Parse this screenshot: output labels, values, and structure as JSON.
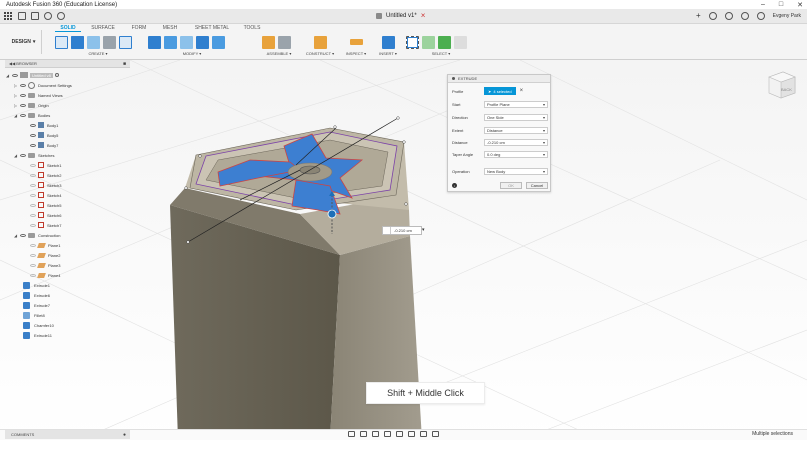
{
  "titlebar": {
    "title": "Autodesk Fusion 360 (Education License)"
  },
  "document": {
    "tab_title": "Untitled v1*"
  },
  "user": {
    "name": "Evgeny Park"
  },
  "workspace": {
    "label": "DESIGN"
  },
  "ribbon": {
    "tabs": [
      "SOLID",
      "SURFACE",
      "FORM",
      "MESH",
      "SHEET METAL",
      "TOOLS"
    ],
    "active_tab": "SOLID",
    "groups": {
      "create": "CREATE",
      "modify": "MODIFY",
      "assemble": "ASSEMBLE",
      "construct": "CONSTRUCT",
      "inspect": "INSPECT",
      "insert": "INSERT",
      "select": "SELECT"
    }
  },
  "browser": {
    "title": "BROWSER",
    "root": "Untitled v8",
    "items": [
      {
        "label": "Document Settings",
        "kind": "settings",
        "indent": 1
      },
      {
        "label": "Named Views",
        "kind": "folder",
        "indent": 1
      },
      {
        "label": "Origin",
        "kind": "folder",
        "indent": 1
      },
      {
        "label": "Bodies",
        "kind": "folder",
        "indent": 1
      },
      {
        "label": "Body1",
        "kind": "body",
        "indent": 2
      },
      {
        "label": "Body5",
        "kind": "body",
        "indent": 2
      },
      {
        "label": "Body7",
        "kind": "body",
        "indent": 2
      },
      {
        "label": "Sketches",
        "kind": "folder",
        "indent": 1
      },
      {
        "label": "Sketch1",
        "kind": "sketch",
        "indent": 2
      },
      {
        "label": "Sketch2",
        "kind": "sketch",
        "indent": 2
      },
      {
        "label": "Sketch3",
        "kind": "sketch",
        "indent": 2
      },
      {
        "label": "Sketch4",
        "kind": "sketch",
        "indent": 2
      },
      {
        "label": "Sketch5",
        "kind": "sketch",
        "indent": 2
      },
      {
        "label": "Sketch6",
        "kind": "sketch",
        "indent": 2
      },
      {
        "label": "Sketch7",
        "kind": "sketch",
        "indent": 2
      },
      {
        "label": "Construction",
        "kind": "folder",
        "indent": 1
      },
      {
        "label": "Plane1",
        "kind": "plane",
        "indent": 2
      },
      {
        "label": "Plane2",
        "kind": "plane",
        "indent": 2
      },
      {
        "label": "Plane3",
        "kind": "plane",
        "indent": 2
      },
      {
        "label": "Plane4",
        "kind": "plane",
        "indent": 2
      },
      {
        "label": "Extrude1",
        "kind": "feature",
        "indent": 1
      },
      {
        "label": "Extrude6",
        "kind": "feature",
        "indent": 1
      },
      {
        "label": "Extrude7",
        "kind": "feature",
        "indent": 1
      },
      {
        "label": "Fillet8",
        "kind": "fillet",
        "indent": 1
      },
      {
        "label": "Chamfer10",
        "kind": "feature",
        "indent": 1
      },
      {
        "label": "Extrude11",
        "kind": "feature",
        "indent": 1
      }
    ]
  },
  "extrude": {
    "title": "EXTRUDE",
    "profile_label": "Profile",
    "profile_value": "4 selected",
    "start_label": "Start",
    "start_value": "Profile Plane",
    "direction_label": "Direction",
    "direction_value": "One Side",
    "extent_label": "Extent",
    "extent_value": "Distance",
    "distance_label": "Distance",
    "distance_value": "-0.210 cm",
    "taper_label": "Taper Angle",
    "taper_value": "0.0 deg",
    "operation_label": "Operation",
    "operation_value": "New Body",
    "ok_label": "OK",
    "cancel_label": "Cancel"
  },
  "viewport": {
    "distance_readout": "-0.210 cm",
    "viewcube_label": "BACK",
    "tooltip": "Shift + Middle Click"
  },
  "status": {
    "comments": "COMMENTS",
    "selection": "Multiple selections"
  },
  "colors": {
    "accent": "#0696d7",
    "profile_blue": "#3d7fd1",
    "body_tan": "#7a715f"
  }
}
